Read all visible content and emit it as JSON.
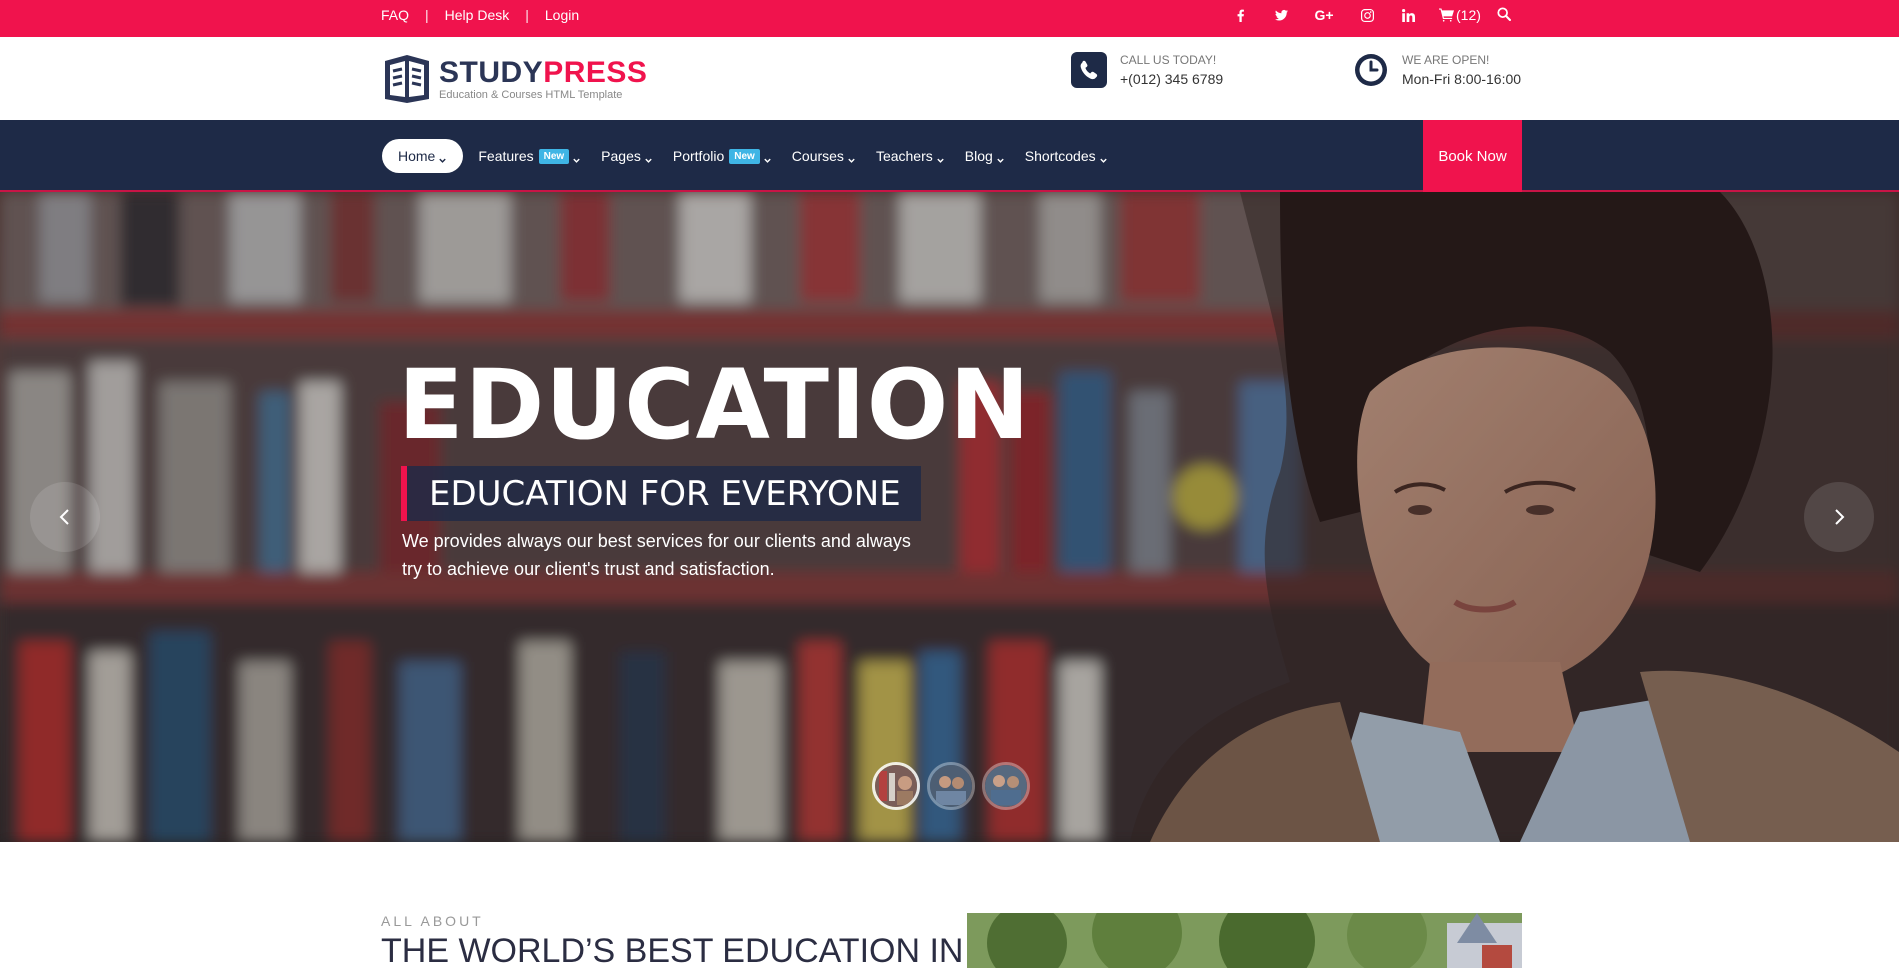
{
  "topbar": {
    "links": [
      "FAQ",
      "Help Desk",
      "Login"
    ],
    "separator": "|",
    "social_icons": [
      "facebook-icon",
      "twitter-icon",
      "google-plus-icon",
      "instagram-icon",
      "linkedin-icon"
    ],
    "cart_count": "(12)",
    "colors": {
      "bg": "#f0134d"
    }
  },
  "header": {
    "logo": {
      "name_part1": "STUDY",
      "name_part2": "PRESS",
      "tagline": "Education & Courses HTML Template"
    },
    "call": {
      "label": "CALL US TODAY!",
      "value": "+(012) 345 6789",
      "icon": "phone-icon"
    },
    "open": {
      "label": "WE ARE OPEN!",
      "value": "Mon-Fri 8:00-16:00",
      "icon": "clock-icon"
    }
  },
  "nav": {
    "items": [
      {
        "label": "Home",
        "active": true
      },
      {
        "label": "Features",
        "badge": "New"
      },
      {
        "label": "Pages"
      },
      {
        "label": "Portfolio",
        "badge": "New"
      },
      {
        "label": "Courses"
      },
      {
        "label": "Teachers"
      },
      {
        "label": "Blog"
      },
      {
        "label": "Shortcodes"
      }
    ],
    "cta": "Book Now",
    "colors": {
      "bg": "#1e2a47",
      "accent": "#f0134d",
      "badge": "#3fb5e5"
    }
  },
  "hero": {
    "title": "EDUCATION",
    "subtitle": "EDUCATION FOR EVERYONE",
    "description_line1": "We provides always our best services for our clients and always",
    "description_line2": "try to achieve our client's trust and satisfaction.",
    "slide_thumbs": 3,
    "active_thumb": 0
  },
  "about": {
    "eyebrow": "ALL ABOUT",
    "title": "THE WORLD’S BEST EDUCATION IN"
  }
}
